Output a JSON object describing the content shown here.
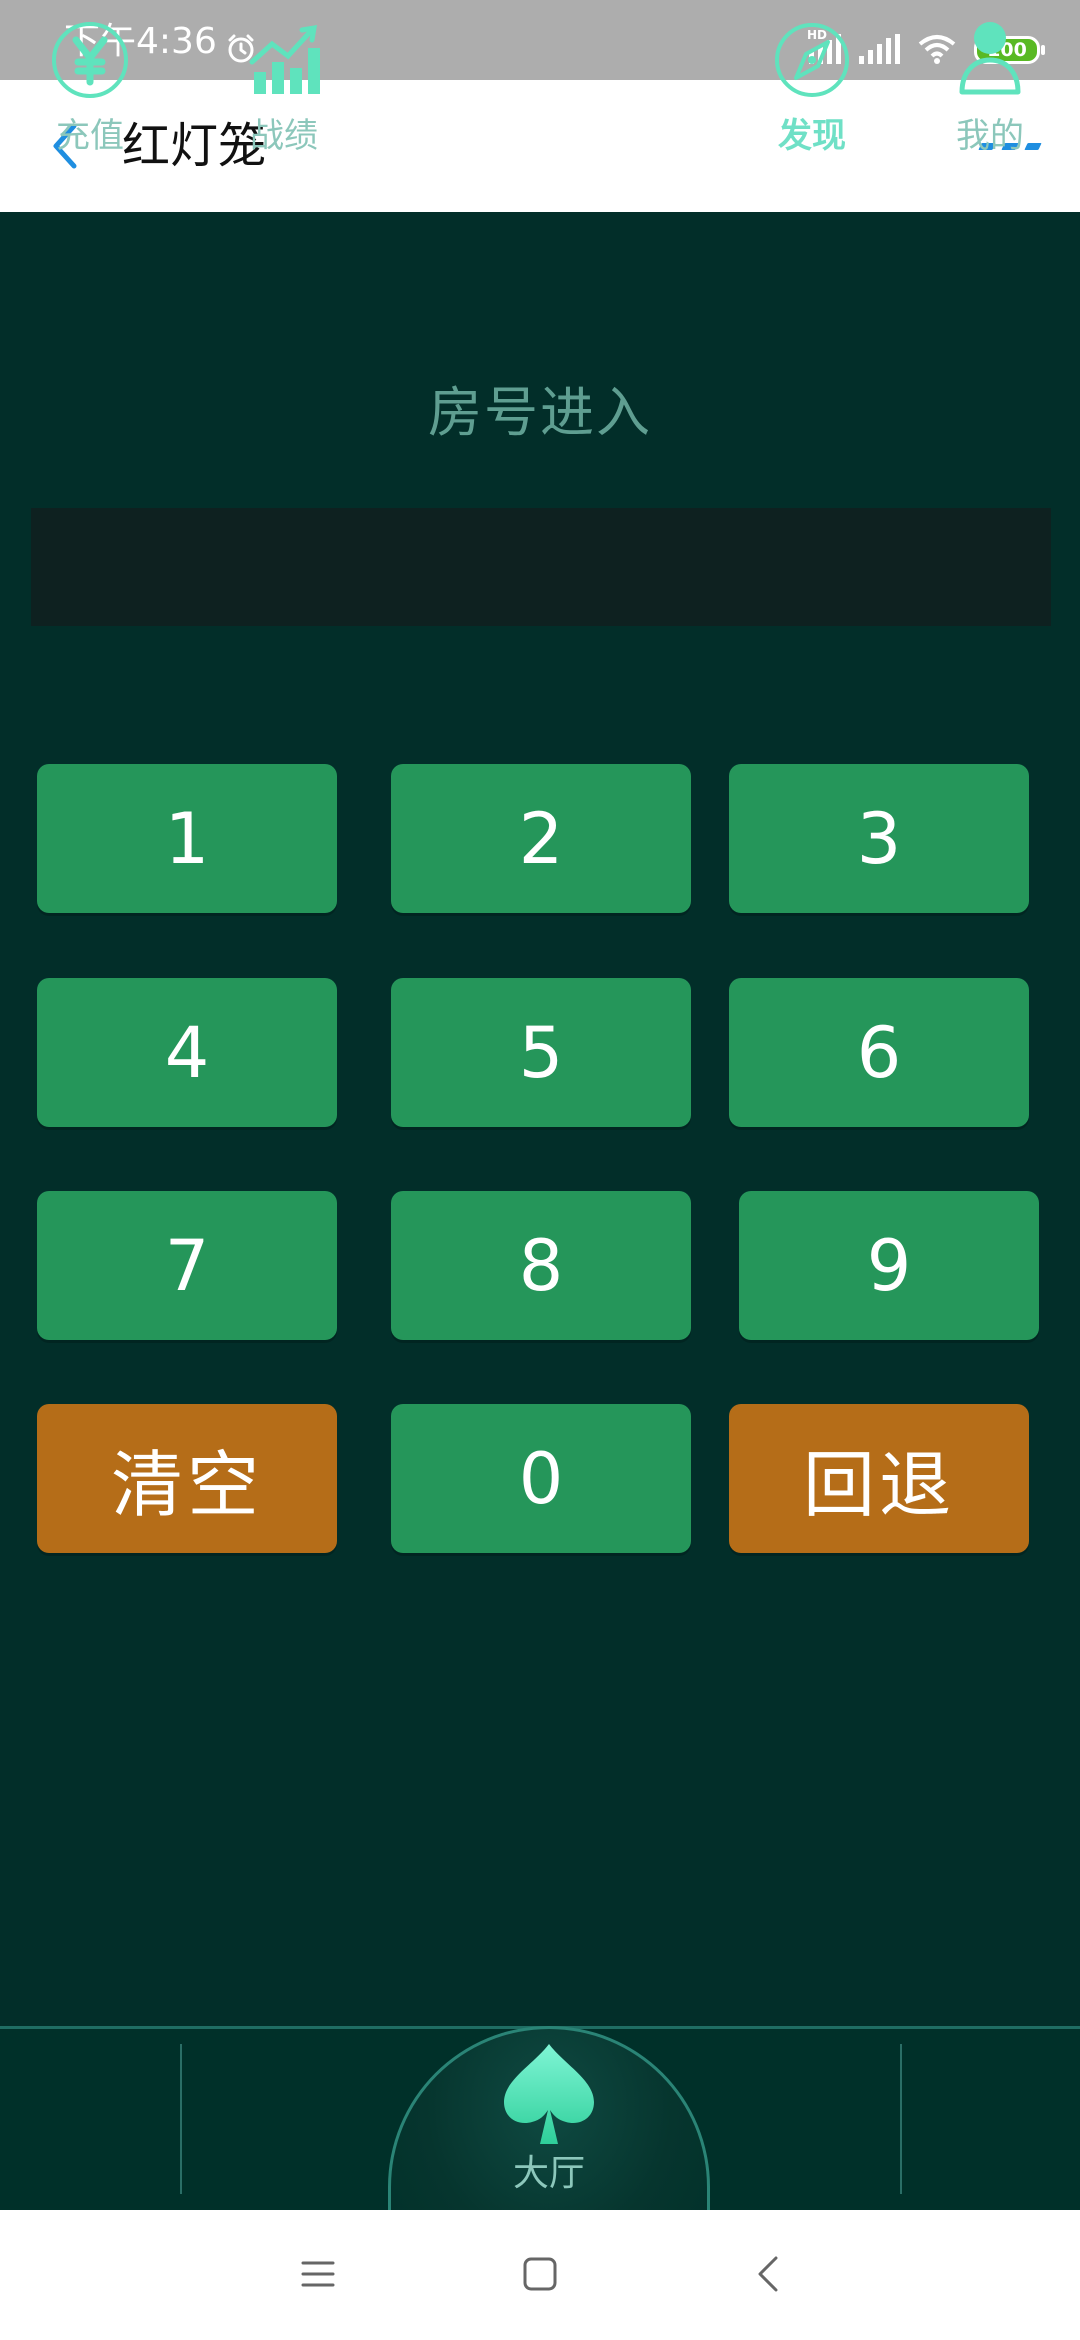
{
  "status_bar": {
    "time": "下午4:36",
    "hd_label": "HD",
    "battery": "100"
  },
  "header": {
    "title": "红灯笼"
  },
  "room_entry": {
    "title": "房号进入",
    "input_value": "",
    "keys": {
      "k1": "1",
      "k2": "2",
      "k3": "3",
      "k4": "4",
      "k5": "5",
      "k6": "6",
      "k7": "7",
      "k8": "8",
      "k9": "9",
      "clear": "清空",
      "k0": "0",
      "back": "回退"
    }
  },
  "tabs": {
    "recharge": "充值",
    "record": "战绩",
    "hall": "大厅",
    "discover": "发现",
    "mine": "我的"
  },
  "colors": {
    "background": "#022e29",
    "key_green": "#25965a",
    "key_orange": "#b56d18",
    "accent_blue": "#1f8ee0",
    "tab_text": "#8cc7bb",
    "tab_active": "#6fe0c6"
  }
}
